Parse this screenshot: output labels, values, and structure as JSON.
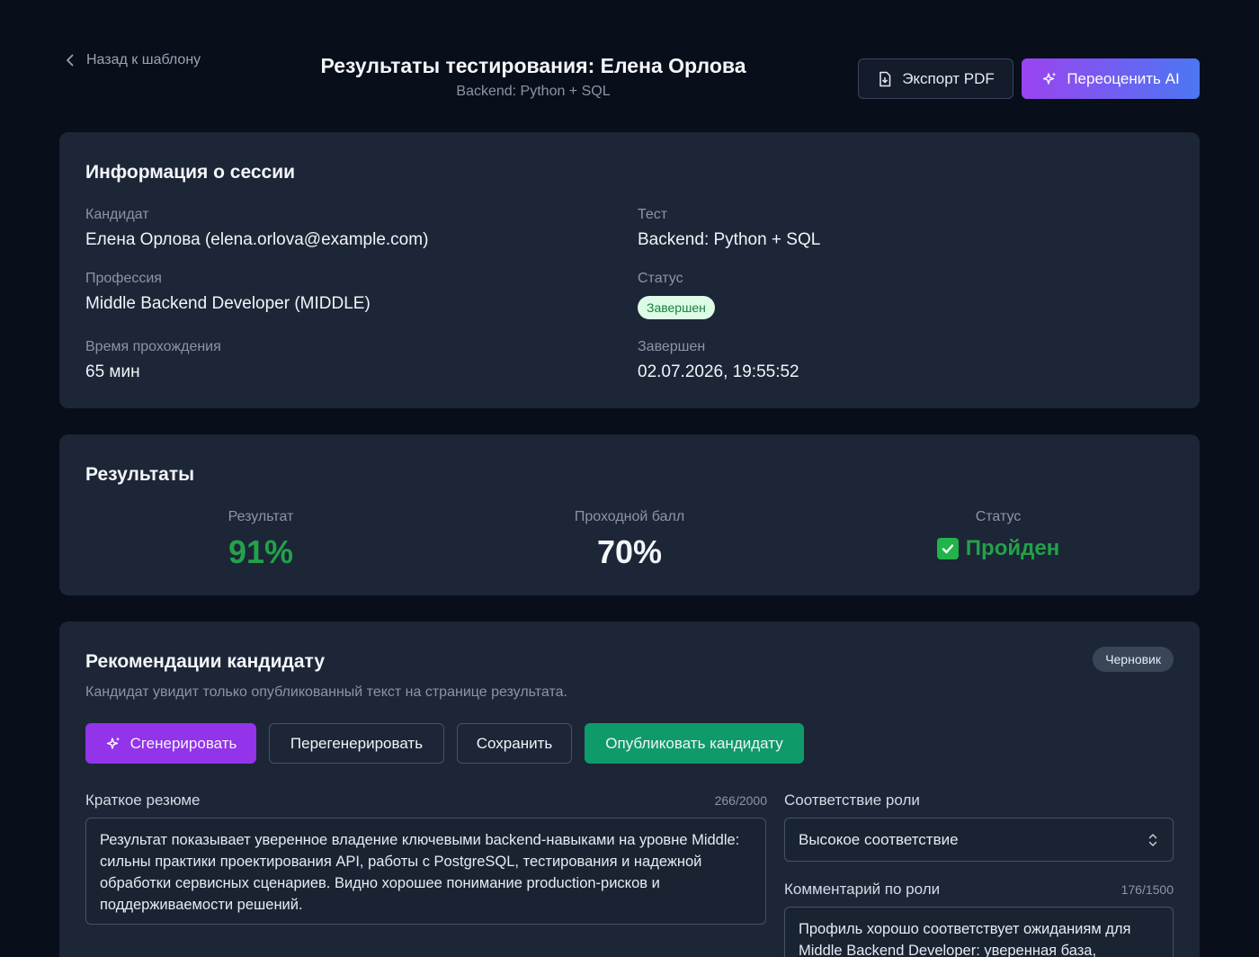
{
  "header": {
    "back_label": "Назад к шаблону",
    "title": "Результаты тестирования: Елена Орлова",
    "subtitle": "Backend: Python + SQL",
    "export_label": "Экспорт PDF",
    "reeval_label": "Переоценить AI",
    "accent_gradient": [
      "#9b44f0",
      "#4b77f2"
    ]
  },
  "session": {
    "title": "Информация о сессии",
    "candidate_label": "Кандидат",
    "candidate_value": "Елена Орлова (elena.orlova@example.com)",
    "test_label": "Тест",
    "test_value": "Backend: Python + SQL",
    "profession_label": "Профессия",
    "profession_value": "Middle Backend Developer (MIDDLE)",
    "status_label": "Статус",
    "status_value": "Завершен",
    "duration_label": "Время прохождения",
    "duration_value": "65 мин",
    "completed_label": "Завершен",
    "completed_value": "02.07.2026, 19:55:52"
  },
  "results": {
    "title": "Результаты",
    "score_label": "Результат",
    "score_value": "91%",
    "pass_label": "Проходной балл",
    "pass_value": "70%",
    "status_label": "Статус",
    "status_value": "Пройден",
    "status_icon": "check-box-icon",
    "success_color": "#22a24a"
  },
  "recommendations": {
    "title": "Рекомендации кандидату",
    "badge": "Черновик",
    "description": "Кандидат увидит только опубликованный текст на странице результата.",
    "generate_label": "Сгенерировать",
    "regenerate_label": "Перегенерировать",
    "save_label": "Сохранить",
    "publish_label": "Опубликовать кандидату",
    "summary_label": "Краткое резюме",
    "summary_counter": "266/2000",
    "summary_text": "Результат показывает уверенное владение ключевыми backend-навыками на уровне Middle: сильны практики проектирования API, работы с PostgreSQL, тестирования и надежной обработки сервисных сценариев. Видно хорошее понимание production-рисков и поддерживаемости решений.",
    "role_fit_label": "Соответствие роли",
    "role_fit_value": "Высокое соответствие",
    "role_comment_label": "Комментарий по роли",
    "role_comment_counter": "176/1500",
    "role_comment_text": "Профиль хорошо соответствует ожиданиям для Middle Backend Developer: уверенная база,"
  }
}
